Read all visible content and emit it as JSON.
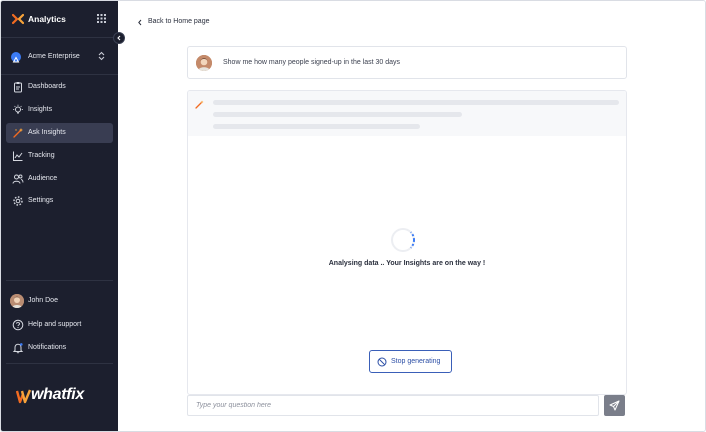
{
  "sidebar": {
    "app_title": "Analytics",
    "org_name": "Acme Enterprise",
    "nav": [
      {
        "label": "Dashboards",
        "icon": "clipboard-icon"
      },
      {
        "label": "Insights",
        "icon": "lightbulb-icon"
      },
      {
        "label": "Ask Insights",
        "icon": "magic-wand-icon",
        "active": true
      },
      {
        "label": "Tracking",
        "icon": "chart-icon"
      },
      {
        "label": "Audience",
        "icon": "users-icon"
      },
      {
        "label": "Settings",
        "icon": "gear-icon"
      }
    ],
    "bottom_nav": [
      {
        "label": "John Doe",
        "icon": "avatar"
      },
      {
        "label": "Help and support",
        "icon": "help-icon"
      },
      {
        "label": "Notifications",
        "icon": "bell-icon"
      }
    ],
    "brand_wordmark": "whatfix"
  },
  "main": {
    "back_label": "Back to Home page",
    "question": "Show me how many people signed-up in the last 30 days",
    "loading_text": "Analysing data .. Your Insights are on the way !",
    "stop_label": "Stop generating",
    "input_placeholder": "Type your question here"
  },
  "colors": {
    "sidebar_bg": "#1c1f2e",
    "active_item_bg": "#393d52",
    "brand_orange": "#f26b21",
    "accent_blue": "#2b4ea5",
    "send_button": "#7a7e8a"
  }
}
